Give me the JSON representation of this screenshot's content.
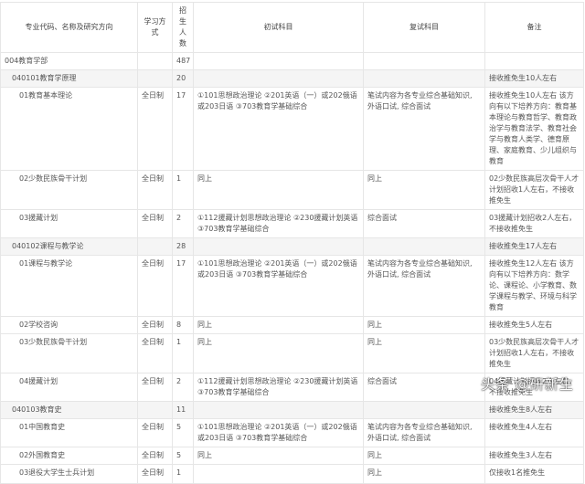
{
  "headers": [
    "专业代码、名称及研究方向",
    "学习方式",
    "招生人数",
    "初试科目",
    "复试科目",
    "备注"
  ],
  "rows": [
    {
      "level": 1,
      "group": false,
      "name": "004教育学部",
      "mode": "",
      "num": "487",
      "exam": "",
      "retest": "",
      "note": ""
    },
    {
      "level": 2,
      "group": true,
      "name": "040101教育学原理",
      "mode": "",
      "num": "20",
      "exam": "",
      "retest": "",
      "note": "接收推免生10人左右"
    },
    {
      "level": 3,
      "group": false,
      "name": "01教育基本理论",
      "mode": "全日制",
      "num": "17",
      "exam": "①101思想政治理论 ②201英语（一）或202俄语或203日语 ③703教育学基础综合",
      "retest": "笔试内容为各专业综合基础知识, 外语口试, 综合面试",
      "note": "接收推免生10人左右 该方向有以下培养方向：教育基本理论与教育哲学、教育政治学与教育法学、教育社会学与教育人类学、德育原理、家庭教育、少儿组织与教育"
    },
    {
      "level": 3,
      "group": false,
      "name": "02少数民族骨干计划",
      "mode": "全日制",
      "num": "1",
      "exam": "同上",
      "retest": "同上",
      "note": "02少数民族高层次骨干人才计划招收1人左右，不接收推免生"
    },
    {
      "level": 3,
      "group": false,
      "name": "03援藏计划",
      "mode": "全日制",
      "num": "2",
      "exam": "①112援藏计划思想政治理论 ②230援藏计划英语 ③703教育学基础综合",
      "retest": "综合面试",
      "note": "03援藏计划招收2人左右，不接收推免生"
    },
    {
      "level": 2,
      "group": true,
      "name": "040102课程与教学论",
      "mode": "",
      "num": "28",
      "exam": "",
      "retest": "",
      "note": "接收推免生17人左右"
    },
    {
      "level": 3,
      "group": false,
      "name": "01课程与教学论",
      "mode": "全日制",
      "num": "17",
      "exam": "①101思想政治理论 ②201英语（一）或202俄语或203日语 ③703教育学基础综合",
      "retest": "笔试内容为各专业综合基础知识, 外语口试, 综合面试",
      "note": "接收推免生12人左右 该方向有以下培养方向：数学论、课程论、小学教育、数学课程与教学、环境与科学教育"
    },
    {
      "level": 3,
      "group": false,
      "name": "02学校咨询",
      "mode": "全日制",
      "num": "8",
      "exam": "同上",
      "retest": "同上",
      "note": "接收推免生5人左右"
    },
    {
      "level": 3,
      "group": false,
      "name": "03少数民族骨干计划",
      "mode": "全日制",
      "num": "1",
      "exam": "同上",
      "retest": "同上",
      "note": "03少数民族高层次骨干人才计划招收1人左右，不接收推免生"
    },
    {
      "level": 3,
      "group": false,
      "name": "04援藏计划",
      "mode": "全日制",
      "num": "2",
      "exam": "①112援藏计划思想政治理论 ②230援藏计划英语 ③703教育学基础综合",
      "retest": "综合面试",
      "note": "04援藏计划招收2人左右，不接收推免生"
    },
    {
      "level": 2,
      "group": true,
      "name": "040103教育史",
      "mode": "",
      "num": "11",
      "exam": "",
      "retest": "",
      "note": "接收推免生8人左右"
    },
    {
      "level": 3,
      "group": false,
      "name": "01中国教育史",
      "mode": "全日制",
      "num": "5",
      "exam": "①101思想政治理论 ②201英语（一）或202俄语或203日语 ③703教育学基础综合",
      "retest": "笔试内容为各专业综合基础知识, 外语口试, 综合面试",
      "note": "接收推免生4人左右"
    },
    {
      "level": 3,
      "group": false,
      "name": "02外国教育史",
      "mode": "全日制",
      "num": "5",
      "exam": "同上",
      "retest": "同上",
      "note": "接收推免生3人左右"
    },
    {
      "level": 3,
      "group": false,
      "name": "03退役大学生士兵计划",
      "mode": "全日制",
      "num": "1",
      "exam": "",
      "retest": "同上",
      "note": "仅接收1名推免生"
    }
  ],
  "watermark": "头条 @研新生"
}
